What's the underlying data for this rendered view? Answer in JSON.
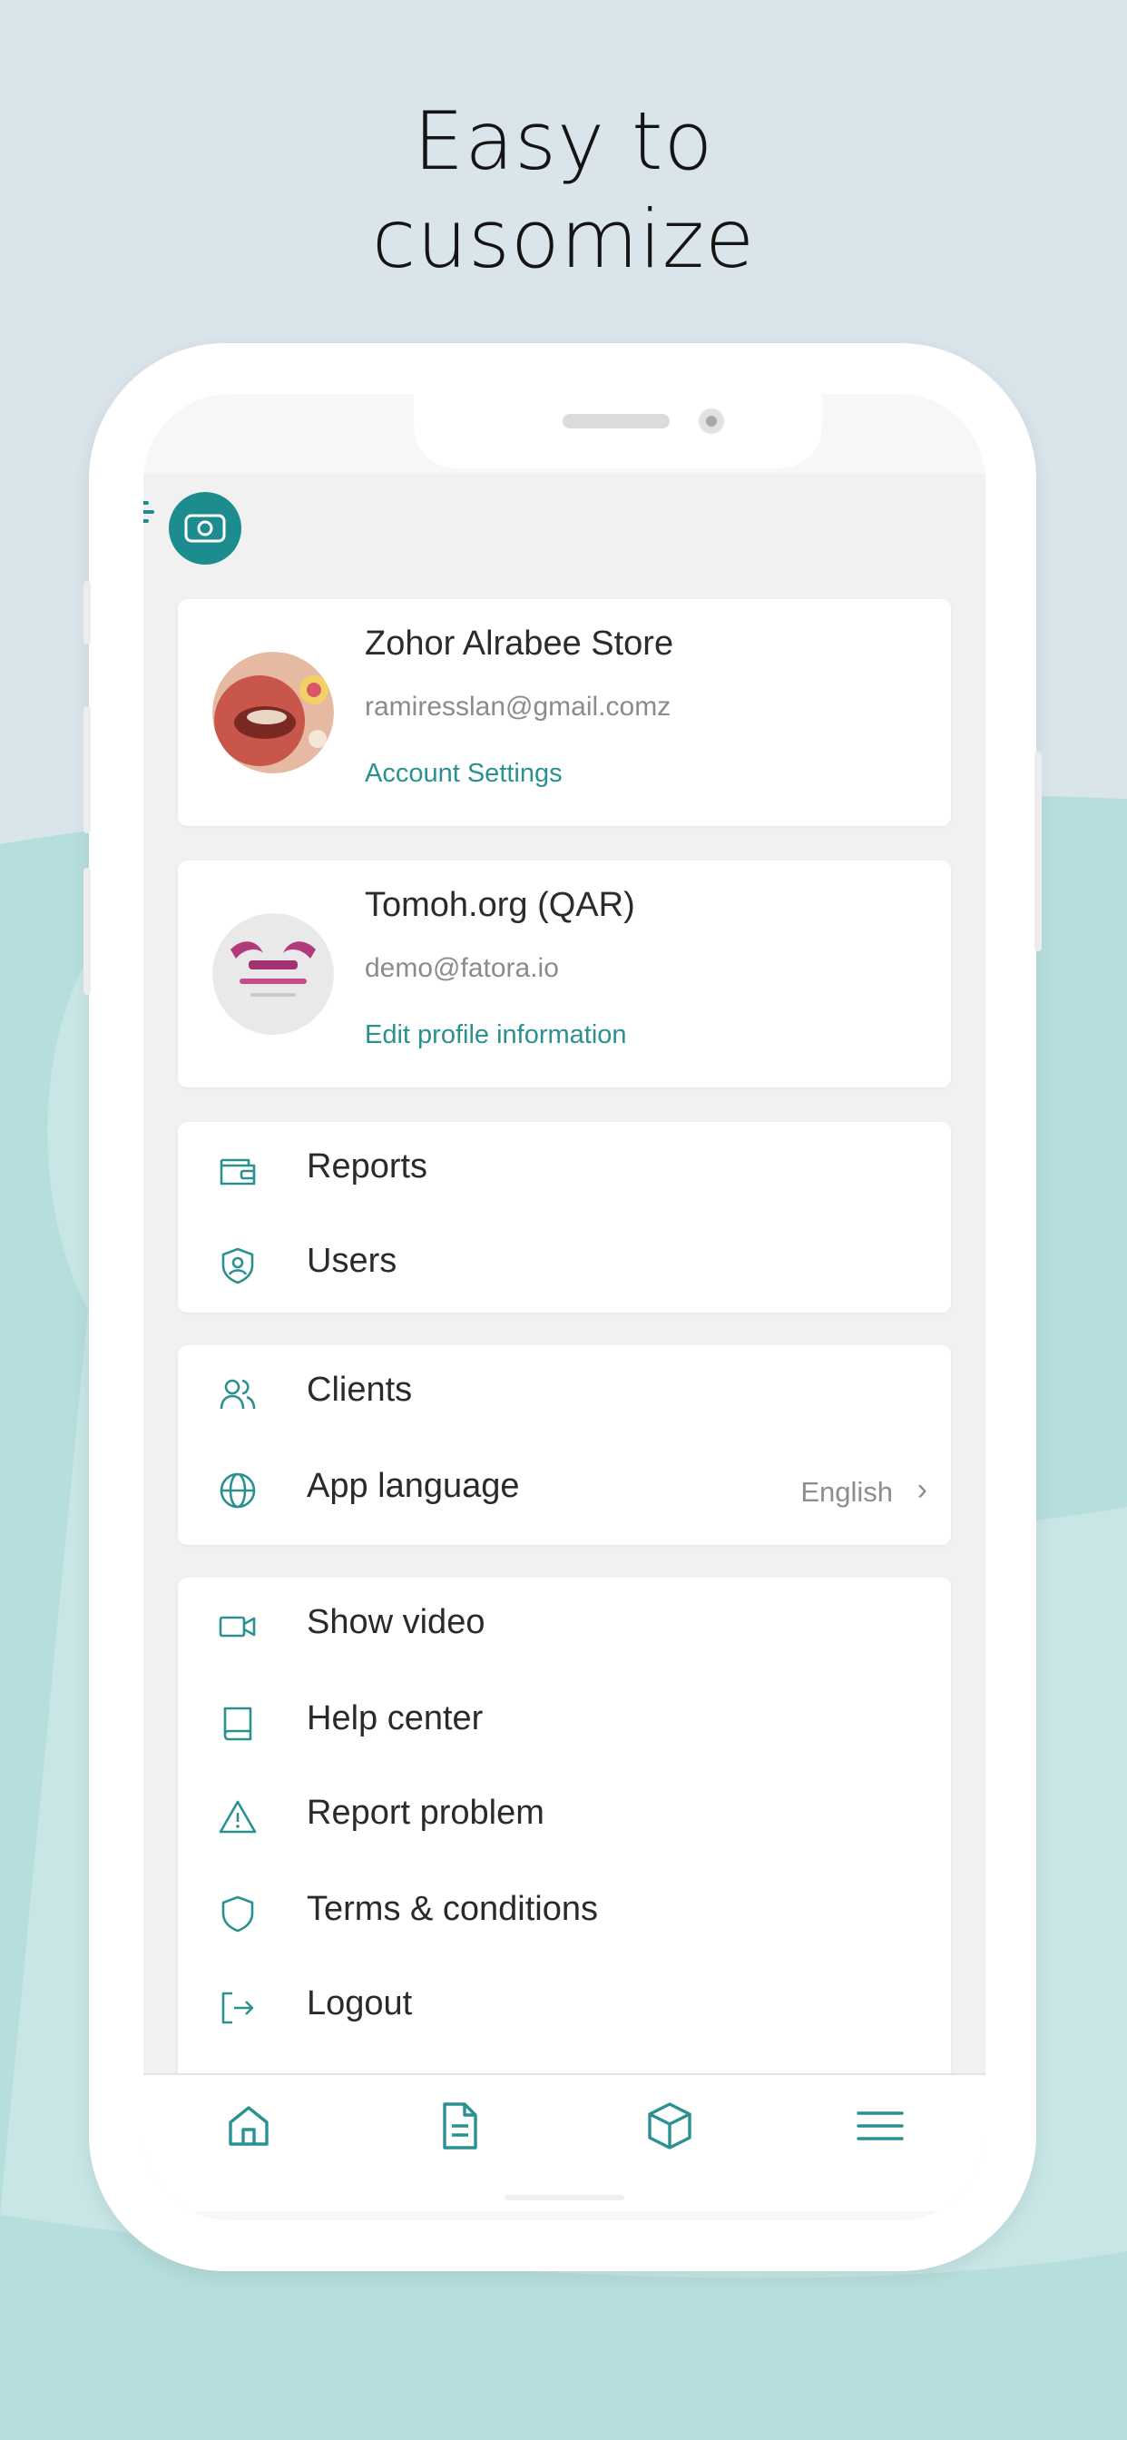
{
  "headline": {
    "line1": "Easy to",
    "line2": "cusomize"
  },
  "colors": {
    "accent": "#2a9190",
    "background": "#d9e4eb",
    "wave": "#b6dedd"
  },
  "app": {
    "logo_icon": "fatora-logo-icon",
    "profiles": [
      {
        "name": "Zohor Alrabee Store",
        "email": "ramiresslan@gmail.comz",
        "link": "Account Settings"
      },
      {
        "name": "Tomoh.org (QAR)",
        "email": "demo@fatora.io",
        "link": "Edit profile information"
      }
    ],
    "menu_groups": [
      [
        {
          "label": "Reports",
          "icon": "wallet-icon"
        },
        {
          "label": "Users",
          "icon": "user-shield-icon"
        }
      ],
      [
        {
          "label": "Clients",
          "icon": "users-icon"
        },
        {
          "label": "App language",
          "icon": "globe-icon",
          "value": "English"
        }
      ],
      [
        {
          "label": "Show video",
          "icon": "video-icon"
        },
        {
          "label": "Help center",
          "icon": "book-icon"
        },
        {
          "label": "Report problem",
          "icon": "warning-icon"
        },
        {
          "label": "Terms & conditions",
          "icon": "shield-icon"
        },
        {
          "label": "Logout",
          "icon": "logout-icon"
        }
      ]
    ],
    "tabbar": [
      "home-icon",
      "document-icon",
      "box-icon",
      "menu-icon"
    ]
  }
}
